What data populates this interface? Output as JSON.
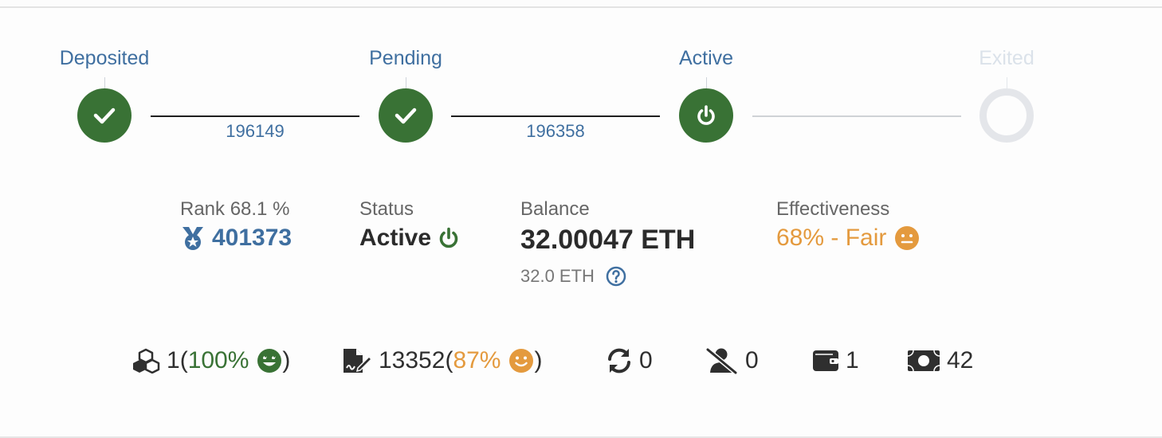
{
  "timeline": {
    "steps": [
      {
        "label": "Deposited",
        "state": "done",
        "icon": "check-icon"
      },
      {
        "label": "Pending",
        "state": "done",
        "icon": "check-icon"
      },
      {
        "label": "Active",
        "state": "active",
        "icon": "power-icon"
      },
      {
        "label": "Exited",
        "state": "inactive",
        "icon": "empty-ring-icon"
      }
    ],
    "epochs": [
      "196149",
      "196358"
    ]
  },
  "stats": {
    "rank": {
      "label": "Rank 68.1 %",
      "value": "401373",
      "icon": "medal-icon"
    },
    "status": {
      "label": "Status",
      "value": "Active",
      "icon": "power-icon"
    },
    "balance": {
      "label": "Balance",
      "value": "32.00047 ETH",
      "effective": "32.0 ETH",
      "help_icon": "question-circle-icon"
    },
    "effectiveness": {
      "label": "Effectiveness",
      "value": "68% - Fair",
      "icon": "neutral-face-icon"
    }
  },
  "metrics": {
    "proposals": {
      "count": "1",
      "open": "(",
      "percent": "100%",
      "close": ")",
      "icon": "cubes-icon",
      "face_icon": "happy-face-icon"
    },
    "attestations": {
      "count": "13352",
      "open": "(",
      "percent": "87%",
      "close": ")",
      "icon": "file-signature-icon",
      "face_icon": "smile-face-icon"
    },
    "sync": {
      "count": "0",
      "icon": "sync-icon"
    },
    "slashings": {
      "count": "0",
      "icon": "user-slash-icon"
    },
    "deposits": {
      "count": "1",
      "icon": "wallet-icon"
    },
    "withdrawals": {
      "count": "42",
      "icon": "money-bill-icon"
    }
  },
  "colors": {
    "accent_blue": "#3f6fa0",
    "success_green": "#397235",
    "warning_orange": "#e49a3e",
    "muted": "#dbe2ea"
  }
}
